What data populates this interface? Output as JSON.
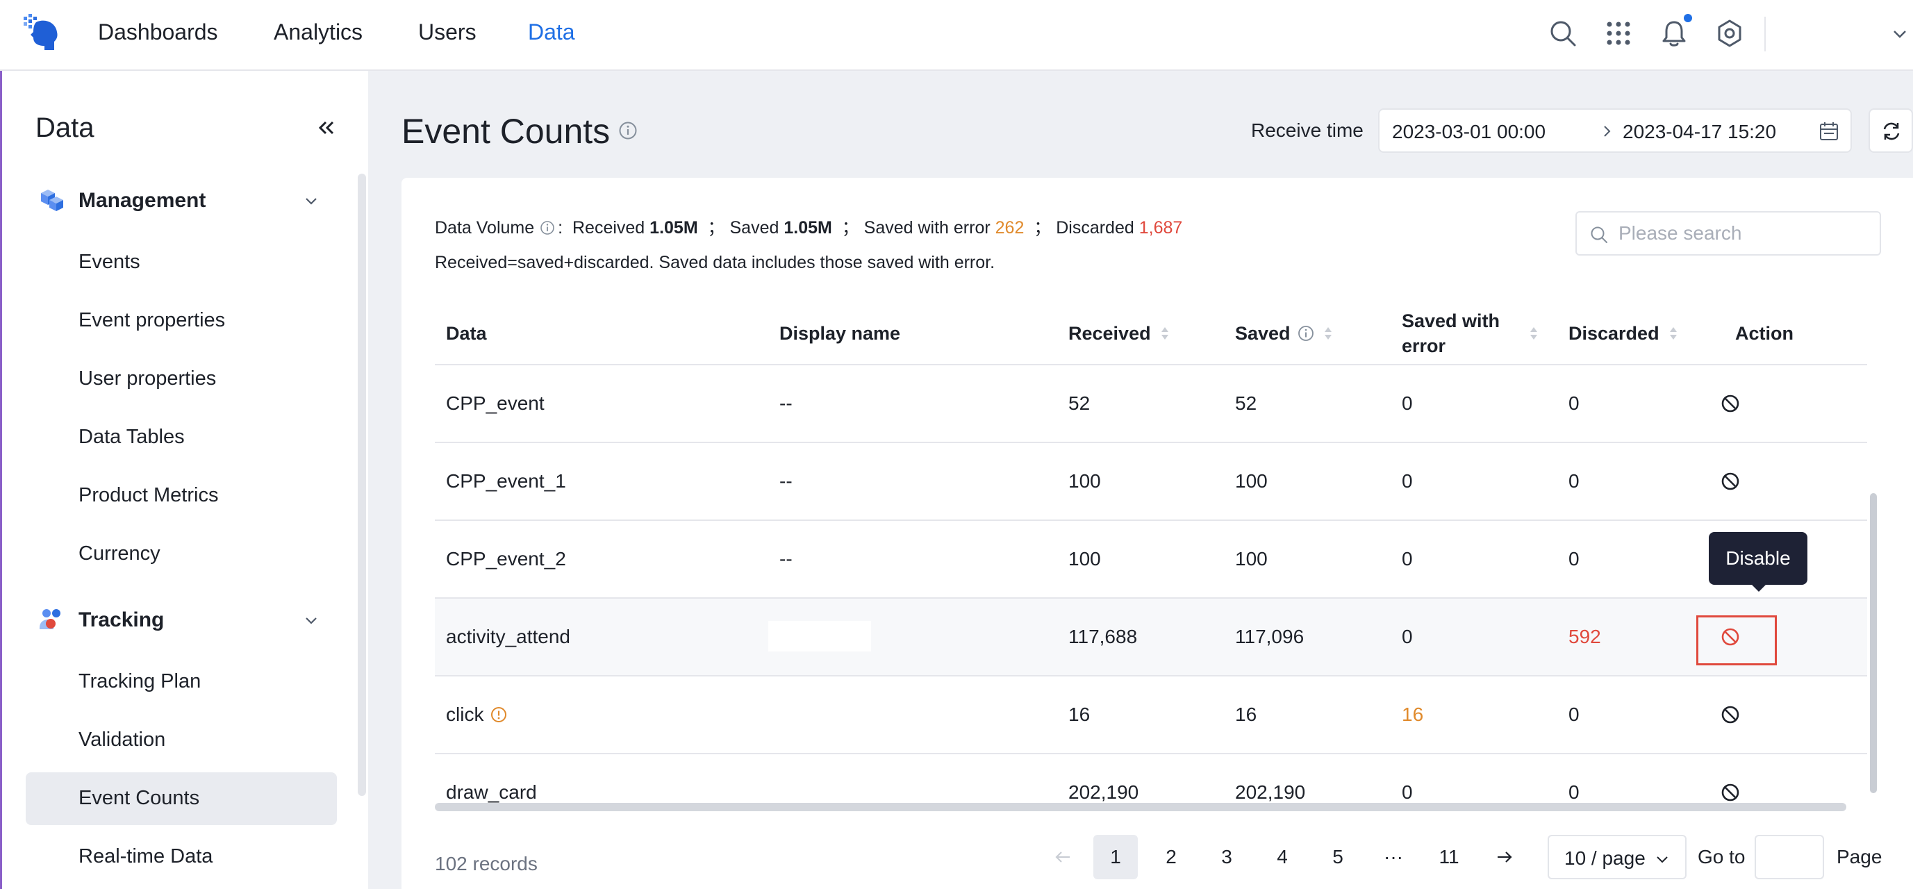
{
  "nav": {
    "items": [
      {
        "label": "Dashboards",
        "active": false
      },
      {
        "label": "Analytics",
        "active": false
      },
      {
        "label": "Users",
        "active": false
      },
      {
        "label": "Data",
        "active": true
      }
    ]
  },
  "sidebar": {
    "title": "Data",
    "groups": [
      {
        "label": "Management",
        "items": [
          "Events",
          "Event properties",
          "User properties",
          "Data Tables",
          "Product Metrics",
          "Currency"
        ]
      },
      {
        "label": "Tracking",
        "items": [
          "Tracking Plan",
          "Validation",
          "Event Counts",
          "Real-time Data"
        ]
      }
    ],
    "active_item": "Event Counts"
  },
  "page": {
    "title": "Event Counts",
    "receive_time_label": "Receive time",
    "range_start": "2023-03-01 00:00",
    "range_end": "2023-04-17 15:20"
  },
  "summary": {
    "label": "Data Volume",
    "received_label": "Received",
    "received_value": "1.05M",
    "saved_label": "Saved",
    "saved_value": "1.05M",
    "saved_error_label": "Saved with error",
    "saved_error_value": "262",
    "discarded_label": "Discarded",
    "discarded_value": "1,687",
    "note": "Received=saved+discarded. Saved data includes those saved with error."
  },
  "search": {
    "placeholder": "Please search"
  },
  "table": {
    "columns": [
      "Data",
      "Display name",
      "Received",
      "Saved",
      "Saved with error",
      "Discarded",
      "Action"
    ],
    "rows": [
      {
        "data": "CPP_event",
        "display_name": "--",
        "received": "52",
        "saved": "52",
        "saved_error": "0",
        "discarded": "0"
      },
      {
        "data": "CPP_event_1",
        "display_name": "--",
        "received": "100",
        "saved": "100",
        "saved_error": "0",
        "discarded": "0"
      },
      {
        "data": "CPP_event_2",
        "display_name": "--",
        "received": "100",
        "saved": "100",
        "saved_error": "0",
        "discarded": "0"
      },
      {
        "data": "activity_attend",
        "display_name": "",
        "received": "117,688",
        "saved": "117,096",
        "saved_error": "0",
        "discarded": "592"
      },
      {
        "data": "click",
        "display_name": "",
        "received": "16",
        "saved": "16",
        "saved_error": "16",
        "discarded": "0"
      },
      {
        "data": "draw_card",
        "display_name": "",
        "received": "202,190",
        "saved": "202,190",
        "saved_error": "0",
        "discarded": "0"
      }
    ],
    "tooltip": "Disable"
  },
  "footer": {
    "records": "102 records",
    "pages": [
      "1",
      "2",
      "3",
      "4",
      "5",
      "···",
      "11"
    ],
    "current_page": "1",
    "page_size": "10 / page",
    "goto_label": "Go to",
    "page_label": "Page"
  },
  "colors": {
    "accent": "#1f6fe5",
    "warning": "#e08a2c",
    "danger": "#e0493d"
  }
}
